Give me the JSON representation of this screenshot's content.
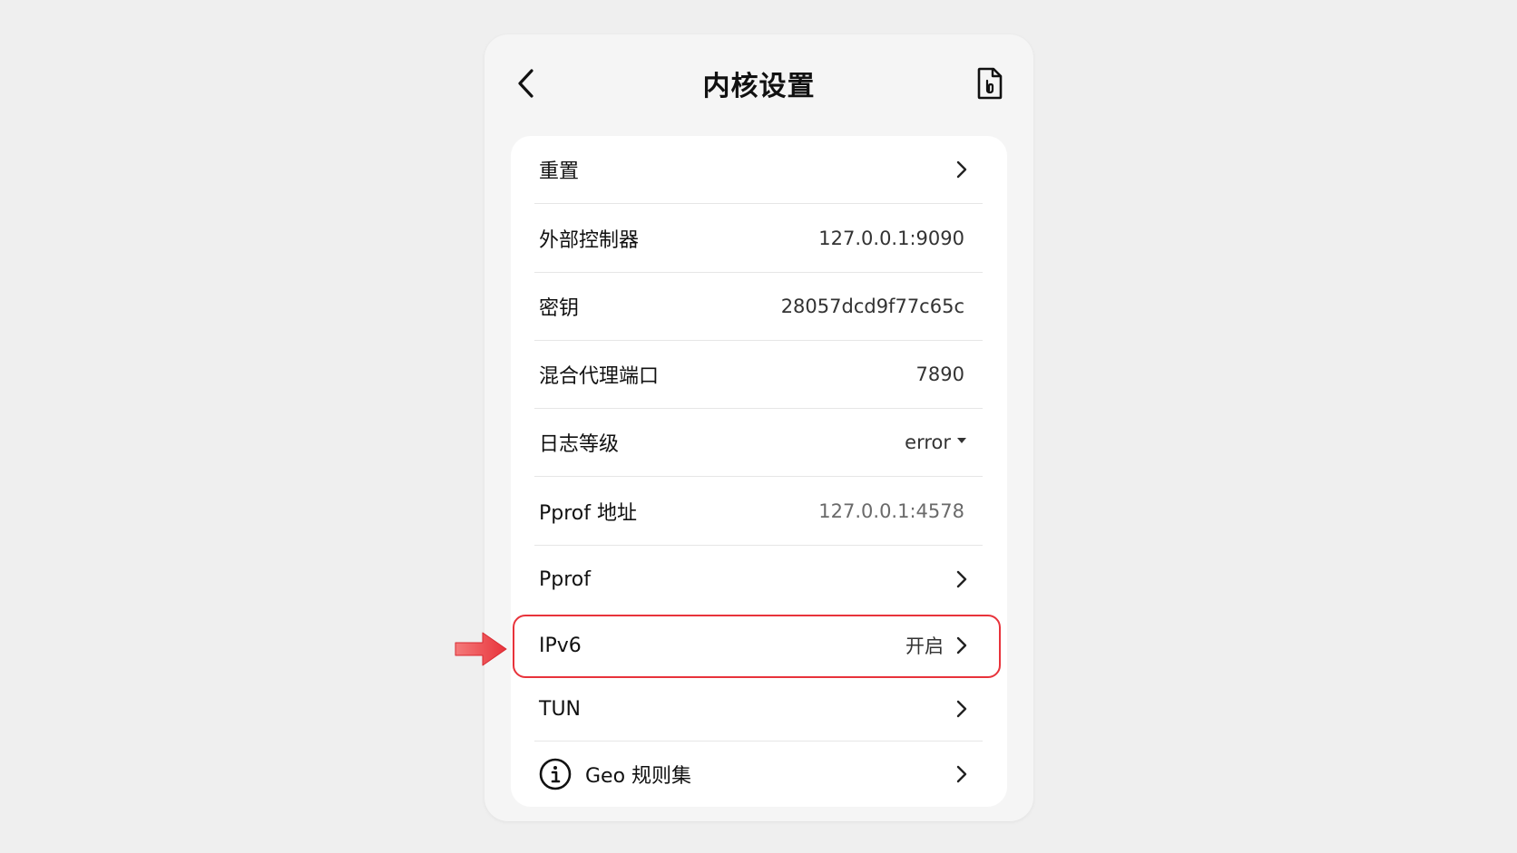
{
  "header": {
    "title": "内核设置",
    "back_icon": "chevron-left-icon",
    "doc_icon": "document-icon"
  },
  "rows": [
    {
      "label": "重置",
      "value": "",
      "trailing": "chevron-right-icon"
    },
    {
      "label": "外部控制器",
      "value": "127.0.0.1:9090"
    },
    {
      "label": "密钥",
      "value": "28057dcd9f77c65c"
    },
    {
      "label": "混合代理端口",
      "value": "7890"
    },
    {
      "label": "日志等级",
      "value": "error",
      "trailing": "dropdown-caret-icon"
    },
    {
      "label": "Pprof 地址",
      "value": "127.0.0.1:4578"
    },
    {
      "label": "Pprof",
      "value": "",
      "trailing": "chevron-right-icon"
    },
    {
      "label": "IPv6",
      "value": "开启",
      "trailing": "chevron-right-icon"
    },
    {
      "label": "TUN",
      "value": "",
      "trailing": "chevron-right-icon"
    },
    {
      "label": "Geo 规则集",
      "value": "",
      "leading": "info-icon",
      "trailing": "chevron-right-icon"
    }
  ],
  "annotation": {
    "highlight_color": "#e8333b",
    "pointer_icon": "red-arrow-icon"
  }
}
